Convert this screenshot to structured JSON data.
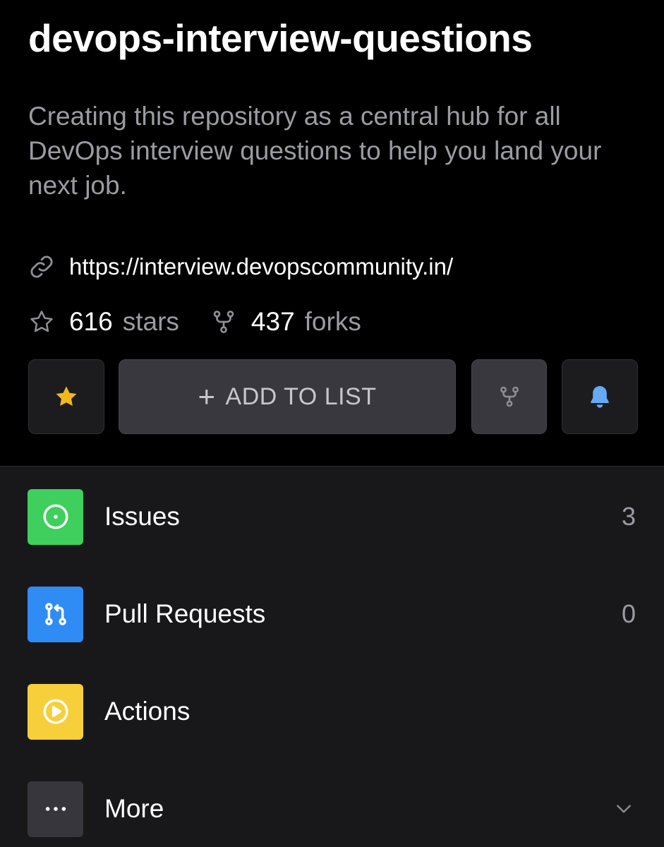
{
  "repo": {
    "name": "devops-interview-questions",
    "description": "Creating this repository as a central hub for all DevOps interview questions to help you land your next job.",
    "link": "https://interview.devopscommunity.in/",
    "stars": "616",
    "stars_label": "stars",
    "forks": "437",
    "forks_label": "forks"
  },
  "actions": {
    "add_to_list_label": "ADD TO LIST",
    "add_to_list_icon": "plus"
  },
  "menu": {
    "items": [
      {
        "label": "Issues",
        "count": "3",
        "icon": "issue-icon",
        "color": "#3ecf5c"
      },
      {
        "label": "Pull Requests",
        "count": "0",
        "icon": "pull-request-icon",
        "color": "#2f8cf5"
      },
      {
        "label": "Actions",
        "icon": "play-icon",
        "color": "#f6cf3a"
      },
      {
        "label": "More",
        "icon": "ellipsis-icon",
        "color": "#36363c"
      }
    ]
  },
  "colors": {
    "star": "#f2b81e",
    "bell": "#66aaf5",
    "text_secondary": "#9b9ba3"
  }
}
